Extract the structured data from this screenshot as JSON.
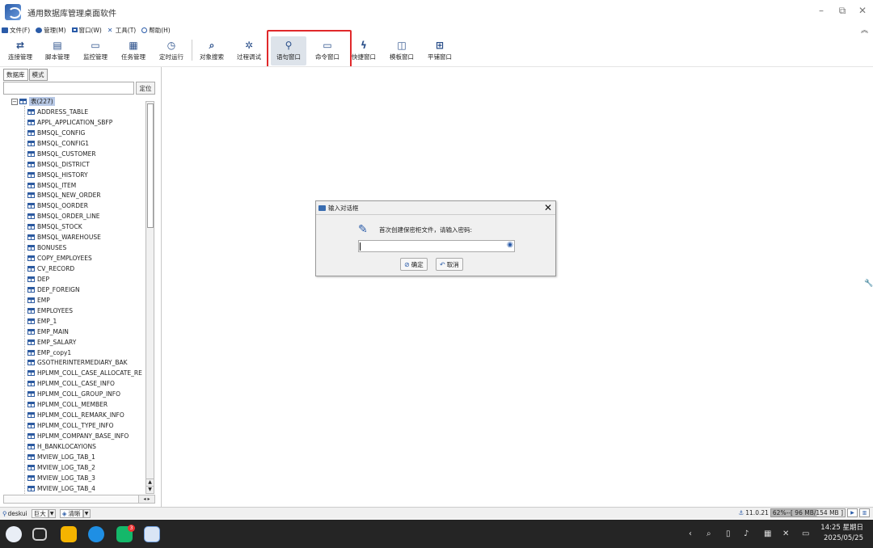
{
  "window": {
    "title": "通用数据库管理桌面软件",
    "minimize": "–",
    "restore": "⧉",
    "close": "✕"
  },
  "menu": {
    "items": [
      {
        "label": "文件(F)",
        "icon": "folder-icon"
      },
      {
        "label": "管理(M)",
        "icon": "gear-icon"
      },
      {
        "label": "窗口(W)",
        "icon": "window-icon"
      },
      {
        "label": "工具(T)",
        "icon": "tools-icon"
      },
      {
        "label": "帮助(H)",
        "icon": "help-icon"
      }
    ],
    "collapse": "︽"
  },
  "toolbar": {
    "buttons": [
      {
        "label": "连接管理",
        "icon": "⇄"
      },
      {
        "label": "脚本管理",
        "icon": "▤"
      },
      {
        "label": "监控管理",
        "icon": "▭"
      },
      {
        "label": "任务管理",
        "icon": "▦"
      },
      {
        "label": "定时运行",
        "icon": "◷"
      },
      {
        "label": "对象搜索",
        "icon": "⌕"
      },
      {
        "label": "过程调试",
        "icon": "✲"
      },
      {
        "label": "语句窗口",
        "icon": "⚲"
      },
      {
        "label": "命令窗口",
        "icon": "▭"
      },
      {
        "label": "快捷窗口",
        "icon": "ϟ"
      },
      {
        "label": "模板窗口",
        "icon": "◫"
      },
      {
        "label": "平铺窗口",
        "icon": "⊞"
      }
    ],
    "active_index": 7
  },
  "left_panel": {
    "tabs": [
      "数据库",
      "模式"
    ],
    "locate_label": "定位",
    "root_label": "表(227)",
    "root_expander": "−",
    "tables": [
      "ADDRESS_TABLE",
      "APPL_APPLICATION_SBFP",
      "BMSQL_CONFIG",
      "BMSQL_CONFIG1",
      "BMSQL_CUSTOMER",
      "BMSQL_DISTRICT",
      "BMSQL_HISTORY",
      "BMSQL_ITEM",
      "BMSQL_NEW_ORDER",
      "BMSQL_OORDER",
      "BMSQL_ORDER_LINE",
      "BMSQL_STOCK",
      "BMSQL_WAREHOUSE",
      "BONUSES",
      "COPY_EMPLOYEES",
      "CV_RECORD",
      "DEP",
      "DEP_FOREIGN",
      "EMP",
      "EMPLOYEES",
      "EMP_1",
      "EMP_MAIN",
      "EMP_SALARY",
      "EMP_copy1",
      "GSOTHERINTERMEDIARY_BAK",
      "HPLMM_COLL_CASE_ALLOCATE_RE",
      "HPLMM_COLL_CASE_INFO",
      "HPLMM_COLL_GROUP_INFO",
      "HPLMM_COLL_MEMBER",
      "HPLMM_COLL_REMARK_INFO",
      "HPLMM_COLL_TYPE_INFO",
      "HPLMM_COMPANY_BASE_INFO",
      "H_BANKLOCAYIONS",
      "MVIEW_LOG_TAB_1",
      "MVIEW_LOG_TAB_2",
      "MVIEW_LOG_TAB_3",
      "MVIEW_LOG_TAB_4"
    ]
  },
  "dialog": {
    "title": "输入对话框",
    "prompt": "首次创建保密柜文件，请输入密码:",
    "value": "",
    "ok_label": "确定",
    "cancel_label": "取消"
  },
  "status": {
    "user": "deskui",
    "font_size": "巨大",
    "theme": "清晰",
    "ip": "11.0.21",
    "memory": "62%--[ 96 MB/154 MB ]",
    "memory_percent": 62
  },
  "taskbar": {
    "time": "14:25 星期日",
    "date": "2025/05/25",
    "badge_count": "3"
  }
}
